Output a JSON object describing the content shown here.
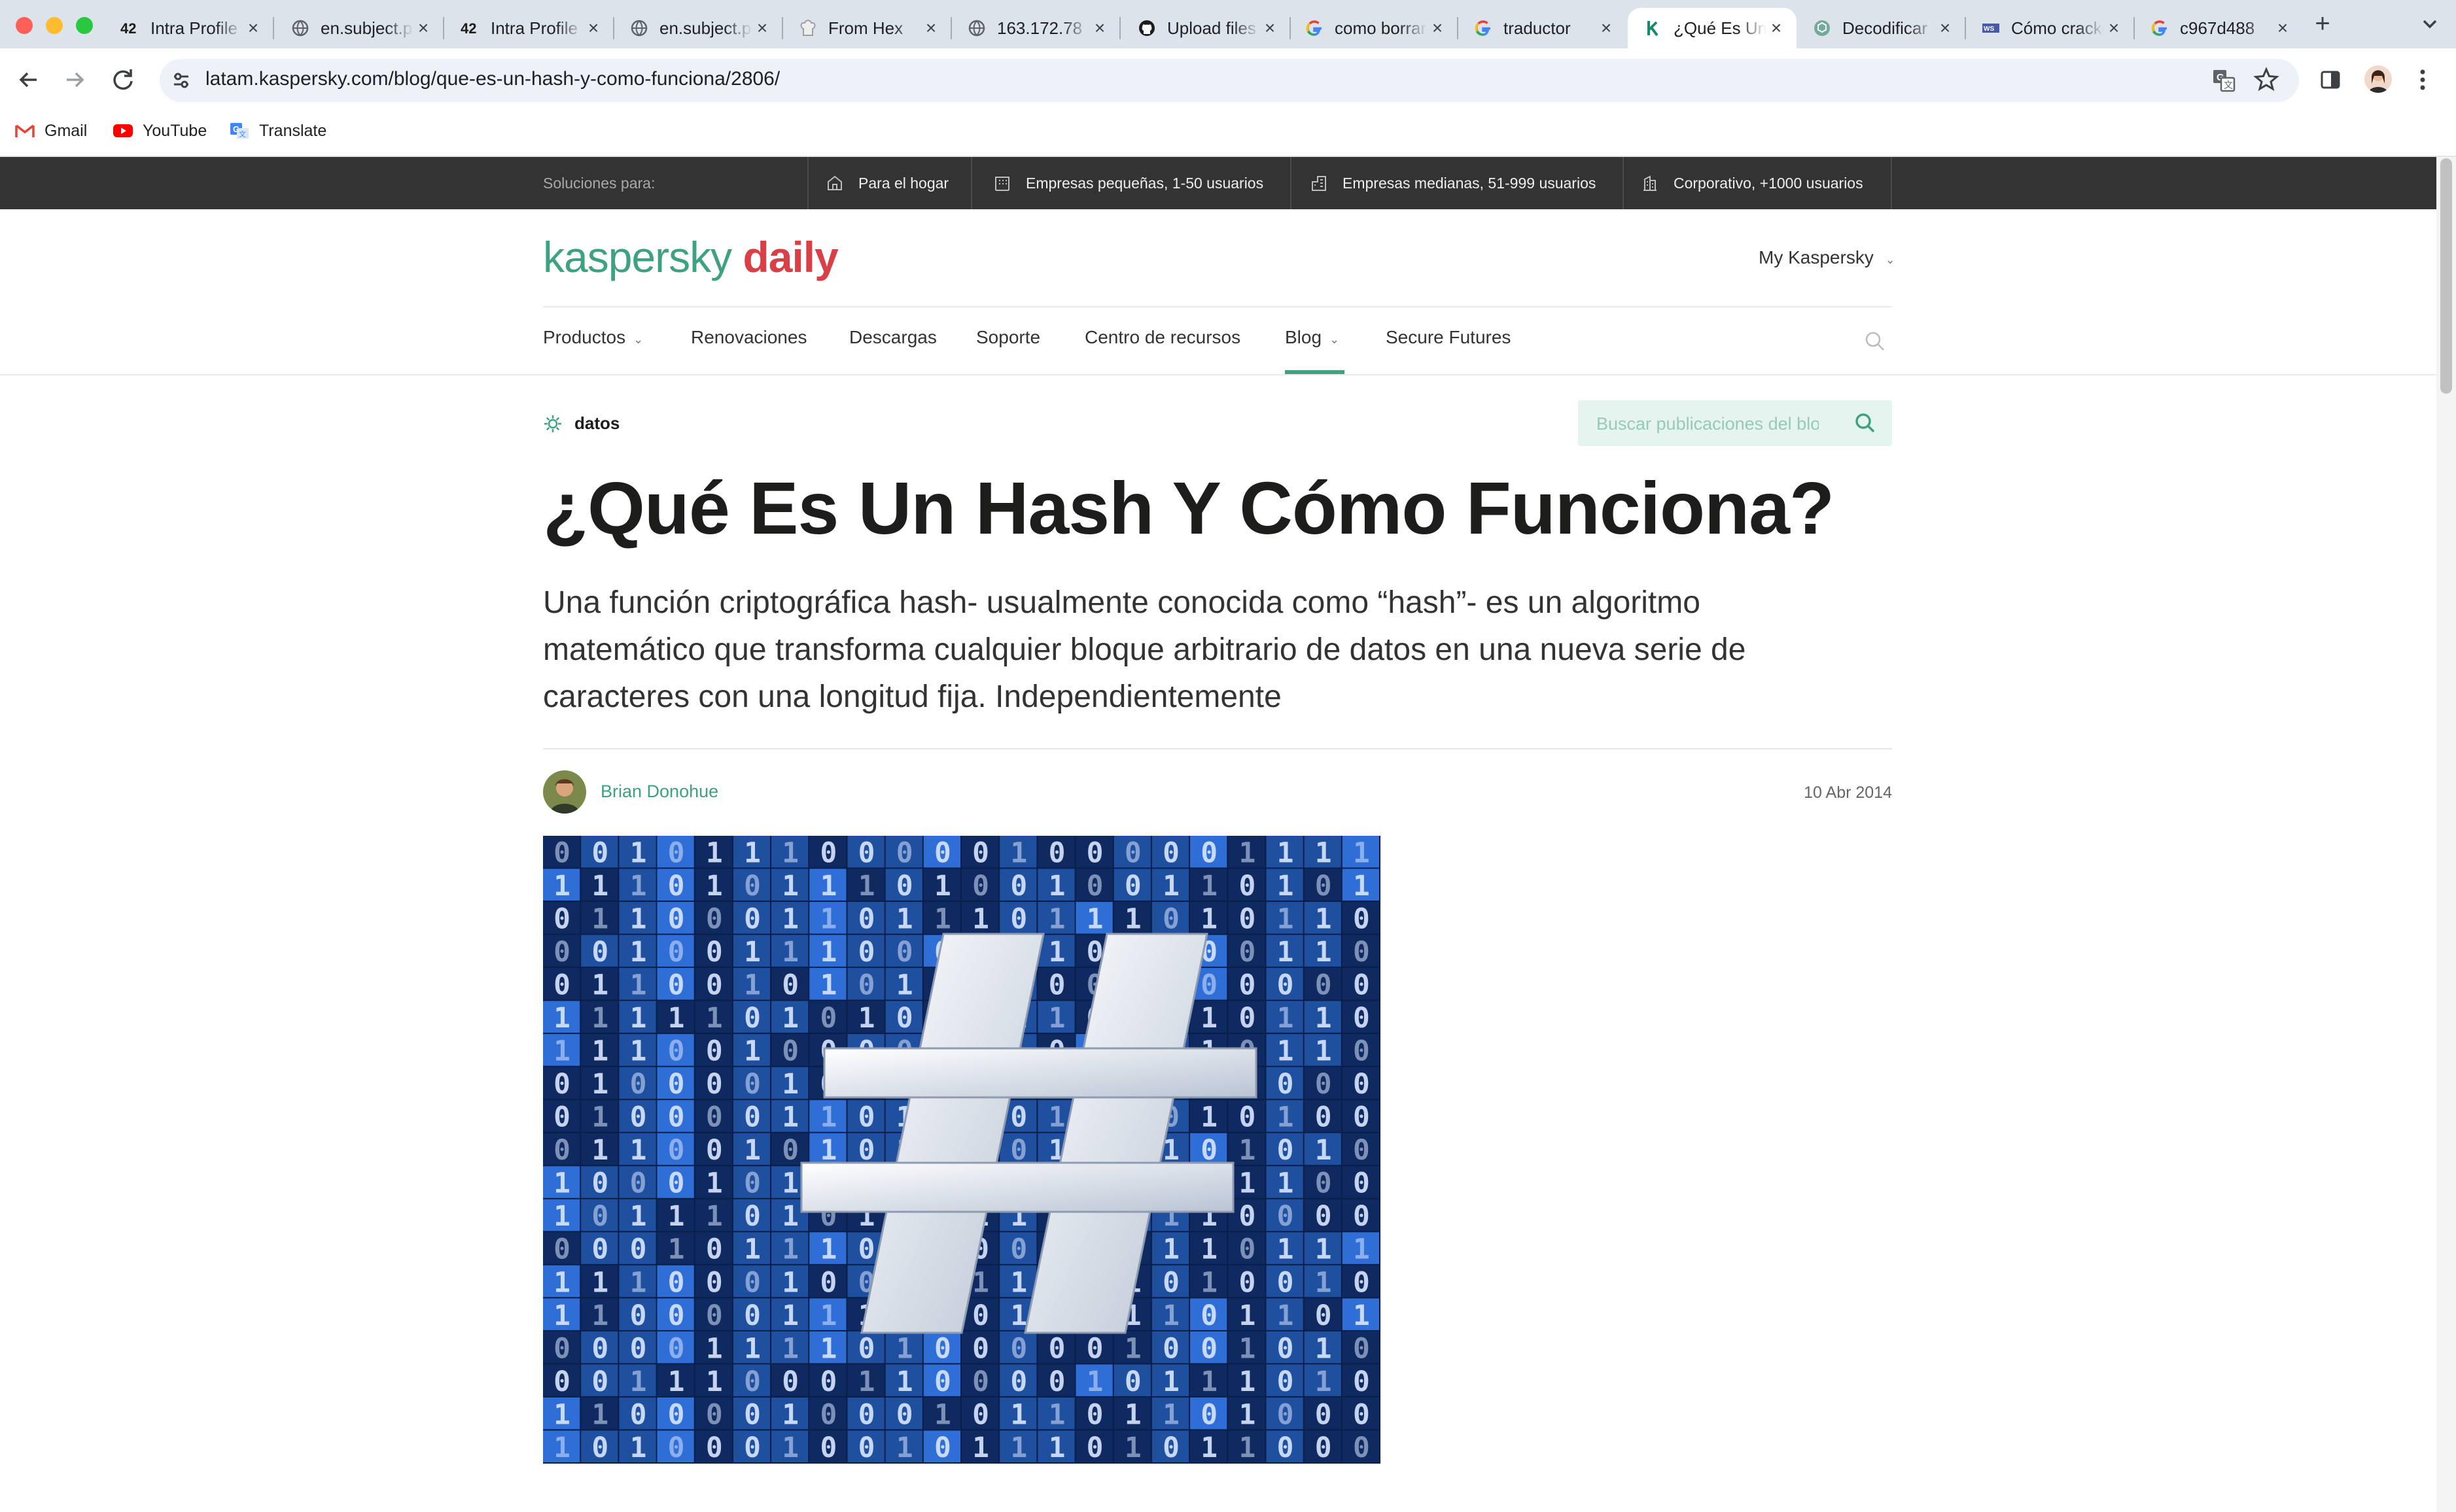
{
  "browser": {
    "tabs": [
      {
        "title": "Intra Profile",
        "icon": "42-logo-icon",
        "active": false
      },
      {
        "title": "en.subject.pdf",
        "icon": "globe-icon",
        "active": false
      },
      {
        "title": "Intra Profile",
        "icon": "42-logo-icon",
        "active": false
      },
      {
        "title": "en.subject.pdf",
        "icon": "globe-icon",
        "active": false
      },
      {
        "title": "From Hex",
        "icon": "cyberchef-icon",
        "active": false
      },
      {
        "title": "163.172.78",
        "icon": "globe-icon",
        "active": false
      },
      {
        "title": "Upload files",
        "icon": "github-icon",
        "active": false
      },
      {
        "title": "como borrar",
        "icon": "google-icon",
        "active": false
      },
      {
        "title": "traductor",
        "icon": "google-icon",
        "active": false
      },
      {
        "title": "¿Qué Es Un Hash",
        "icon": "kaspersky-icon",
        "active": true
      },
      {
        "title": "Decodificar",
        "icon": "openai-icon",
        "active": false
      },
      {
        "title": "Cómo crackear",
        "icon": "site-icon",
        "active": false
      },
      {
        "title": "c967d488",
        "icon": "google-icon",
        "active": false
      }
    ],
    "url": "latam.kaspersky.com/blog/que-es-un-hash-y-como-funciona/2806/",
    "bookmarks": [
      {
        "label": "Gmail",
        "icon": "gmail-icon"
      },
      {
        "label": "YouTube",
        "icon": "youtube-icon"
      },
      {
        "label": "Translate",
        "icon": "translate-icon"
      }
    ]
  },
  "solutions": {
    "label": "Soluciones para:",
    "items": [
      "Para el hogar",
      "Empresas pequeñas, 1-50 usuarios",
      "Empresas medianas, 51-999 usuarios",
      "Corporativo, +1000 usuarios"
    ]
  },
  "header": {
    "logo_brand": "kaspersky",
    "logo_product": "daily",
    "account": "My Kaspersky"
  },
  "nav": {
    "items": [
      "Productos",
      "Renovaciones",
      "Descargas",
      "Soporte",
      "Centro de recursos",
      "Blog",
      "Secure Futures"
    ],
    "active": "Blog"
  },
  "article": {
    "tag": "datos",
    "search_placeholder": "Buscar publicaciones del blog",
    "title": "¿Qué Es Un Hash Y Cómo Funciona?",
    "lead": "Una función criptográfica hash- usualmente conocida como “hash”- es un algoritmo matemático que transforma cualquier bloque arbitrario de datos en una nueva serie de caracteres con una longitud fija. Independientemente",
    "author": "Brian Donohue",
    "date": "10 Abr 2014"
  },
  "hero_image": {
    "symbol": "#",
    "binary_rows": [
      "0010111000001000001111",
      "1110101110100100110101",
      "0110001101110111010110",
      "0010011100011100100110",
      "0110010101110001000000",
      "1111101010101101010110",
      "1110010000101011010110",
      "0100001011010100111000",
      "0100001101100110010100",
      "0110010101110111101010",
      "1000101011000001001100",
      "1011101010011000110000",
      "0001011100000011110111",
      "1110001001011101010010",
      "1100001110101111101101",
      "0000111101000001001010",
      "0011100011000010111010",
      "1100001000101101101000",
      "1010001001011101011000"
    ],
    "colors": {
      "bright": "#2e6ed6",
      "mid": "#1f4f9f",
      "dark": "#0e2a60",
      "digit": "#d9e6ff"
    }
  },
  "colors": {
    "accent": "#3ea182",
    "brand_red": "#d83f47",
    "topbar": "#333333"
  }
}
